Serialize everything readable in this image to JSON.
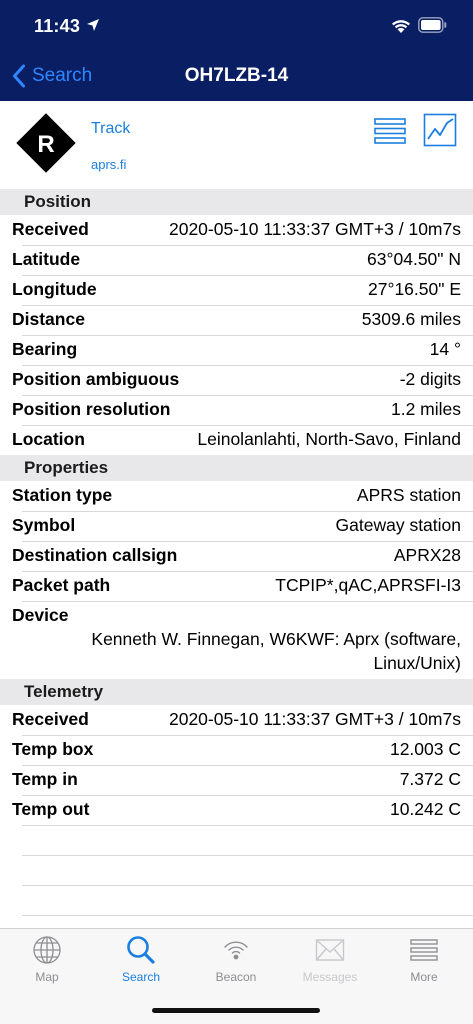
{
  "status_bar": {
    "time": "11:43"
  },
  "nav": {
    "back_label": "Search",
    "title": "OH7LZB-14"
  },
  "header": {
    "logo_letter": "R",
    "track_link": "Track",
    "source_link": "aprs.fi"
  },
  "position": {
    "title": "Position",
    "rows": [
      {
        "label": "Received",
        "value": "2020-05-10 11:33:37 GMT+3 / 10m7s"
      },
      {
        "label": "Latitude",
        "value": "63°04.50\" N"
      },
      {
        "label": "Longitude",
        "value": "27°16.50\" E"
      },
      {
        "label": "Distance",
        "value": "5309.6 miles"
      },
      {
        "label": "Bearing",
        "value": "14 °"
      },
      {
        "label": "Position ambiguous",
        "value": "-2 digits"
      },
      {
        "label": "Position resolution",
        "value": "1.2 miles"
      },
      {
        "label": "Location",
        "value": "Leinolanlahti, North-Savo, Finland"
      }
    ]
  },
  "properties": {
    "title": "Properties",
    "rows": [
      {
        "label": "Station type",
        "value": "APRS station"
      },
      {
        "label": "Symbol",
        "value": "Gateway station"
      },
      {
        "label": "Destination callsign",
        "value": "APRX28"
      },
      {
        "label": "Packet path",
        "value": "TCPIP*,qAC,APRSFI-I3"
      }
    ],
    "device": {
      "label": "Device",
      "line1": "Kenneth W. Finnegan, W6KWF: Aprx (software,",
      "line2": "Linux/Unix)"
    }
  },
  "telemetry": {
    "title": "Telemetry",
    "rows": [
      {
        "label": "Received",
        "value": "2020-05-10 11:33:37 GMT+3 / 10m7s"
      },
      {
        "label": "Temp box",
        "value": "12.003 C"
      },
      {
        "label": "Temp in",
        "value": "7.372 C"
      },
      {
        "label": "Temp out",
        "value": "10.242 C"
      }
    ]
  },
  "tabbar": {
    "map": "Map",
    "search": "Search",
    "beacon": "Beacon",
    "messages": "Messages",
    "more": "More"
  },
  "colors": {
    "nav_background": "#0a1e63",
    "link_blue": "#1a7fe0",
    "active_tab": "#1a7fe0",
    "inactive_tab": "#8e8e93",
    "disabled_tab": "#c8c8cc",
    "section_background": "#e8e8ea"
  }
}
